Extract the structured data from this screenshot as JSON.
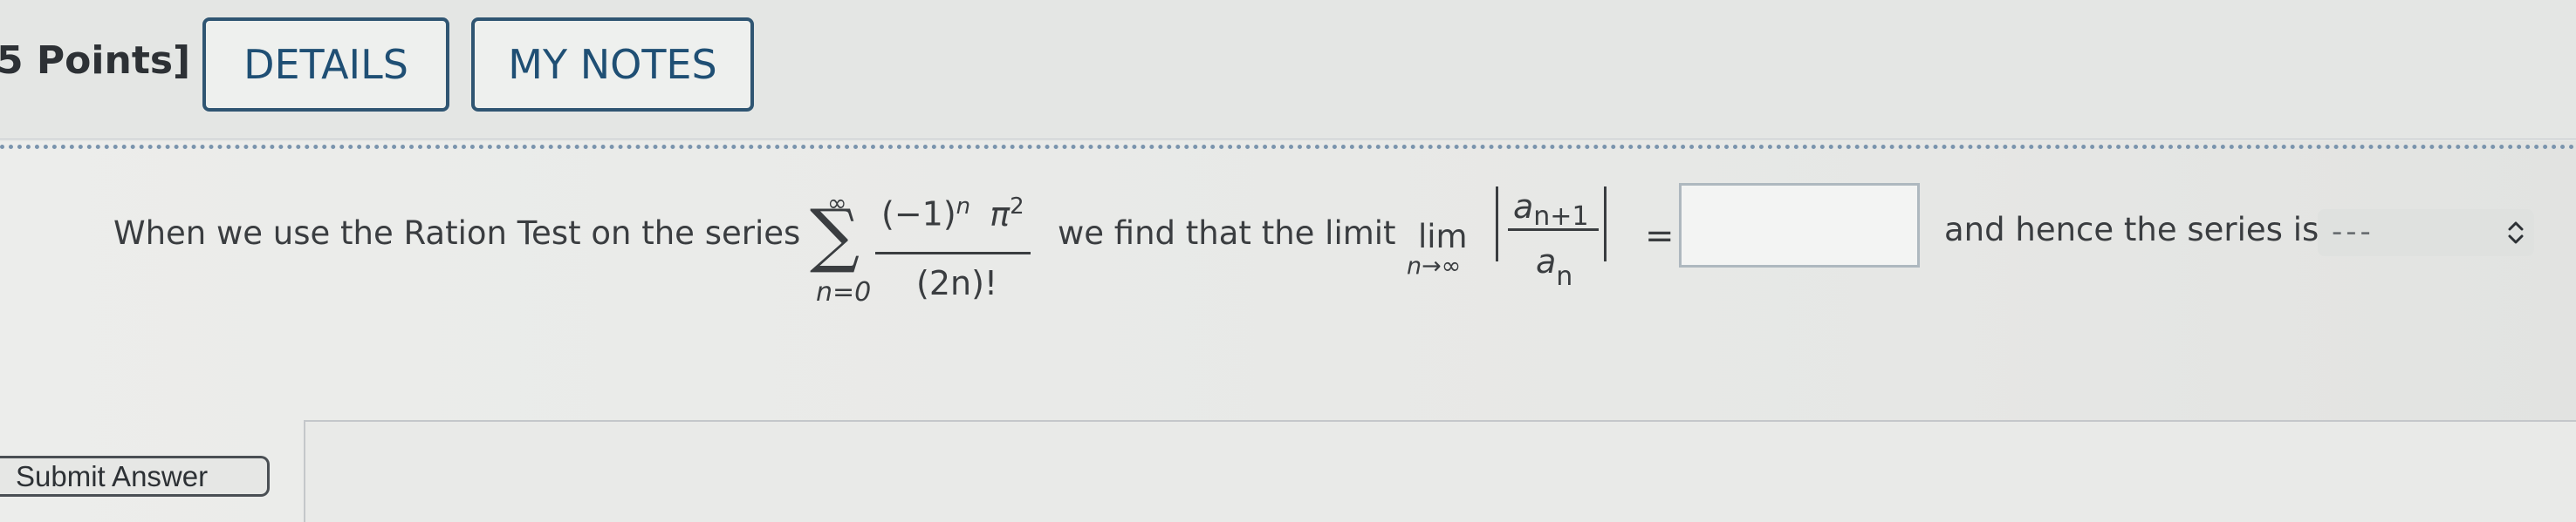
{
  "header": {
    "points_label": "5 Points]",
    "details_label": "DETAILS",
    "notes_label": "MY NOTES"
  },
  "question": {
    "intro": "When we use the Ration Test on the series",
    "sum_upper": "∞",
    "sum_lower": "n=0",
    "term_numerator": "(−1)",
    "term_num_exp_n": "n",
    "term_pi": "π",
    "term_pi_exp": "2",
    "term_denominator": "(2n)!",
    "mid_text": "we find that the limit",
    "lim_word": "lim",
    "lim_sub": "n→∞",
    "ratio_num_var": "a",
    "ratio_num_sub": "n+1",
    "ratio_den_var": "a",
    "ratio_den_sub": "n",
    "equals": "=",
    "answer_value": "",
    "after_text": "and hence the series is",
    "select_value": "---"
  },
  "footer": {
    "submit_label": "Submit Answer"
  },
  "icons": {
    "select_chevron": "up-down-chevron-icon"
  },
  "colors": {
    "button_border": "#2f5572",
    "button_text": "#1f4f74",
    "dotted_rule": "#7a94ad"
  }
}
